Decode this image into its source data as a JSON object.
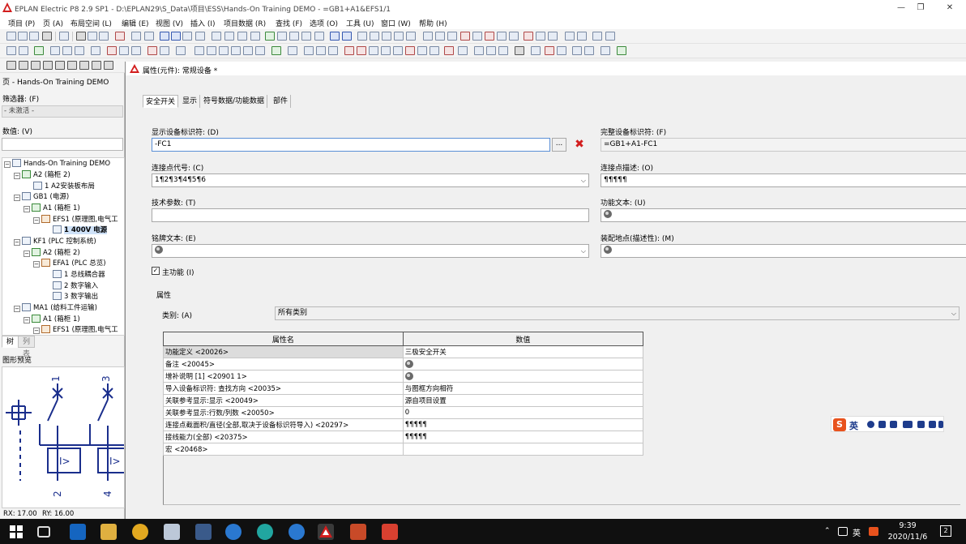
{
  "window": {
    "title": "EPLAN Electric P8 2.9 SP1 - D:\\EPLAN29\\S_Data\\项目\\ESS\\Hands-On Training DEMO - =GB1+A1&EFS1/1",
    "minimize": "—",
    "maximize": "❐",
    "close": "✕"
  },
  "menu": [
    "项目 (P)",
    "页 (A)",
    "布局空间 (L)",
    "编辑 (E)",
    "视图 (V)",
    "插入 (I)",
    "项目数据 (R)",
    "查找 (F)",
    "选项 (O)",
    "工具 (U)",
    "窗口 (W)",
    "帮助 (H)"
  ],
  "left_panel": {
    "title": "页 - Hands-On Training DEMO",
    "filter_label": "筛选器: (F)",
    "filter_value": "- 未激活 -",
    "value_label": "数值: (V)",
    "tree": [
      {
        "level": 0,
        "expander": "−",
        "icon": "project",
        "text": "Hands-On Training DEMO"
      },
      {
        "level": 1,
        "expander": "−",
        "icon": "cabinet",
        "text": "A2 (箱柜 2)"
      },
      {
        "level": 2,
        "expander": "",
        "icon": "page",
        "text": "1 A2安装板布局"
      },
      {
        "level": 1,
        "expander": "−",
        "icon": "function",
        "text": "GB1 (电源)"
      },
      {
        "level": 2,
        "expander": "−",
        "icon": "cabinet",
        "text": "A1 (箱柜 1)"
      },
      {
        "level": 3,
        "expander": "−",
        "icon": "schematic",
        "text": "EFS1 (原理图,电气工"
      },
      {
        "level": 4,
        "expander": "",
        "icon": "page",
        "text": "1 400V 电源",
        "selected": true
      },
      {
        "level": 1,
        "expander": "−",
        "icon": "function",
        "text": "KF1 (PLC 控制系统)"
      },
      {
        "level": 2,
        "expander": "−",
        "icon": "cabinet",
        "text": "A2 (箱柜 2)"
      },
      {
        "level": 3,
        "expander": "−",
        "icon": "schematic",
        "text": "EFA1 (PLC 总览)"
      },
      {
        "level": 4,
        "expander": "",
        "icon": "page",
        "text": "1 总线耦合器"
      },
      {
        "level": 4,
        "expander": "",
        "icon": "page",
        "text": "2 数字输入"
      },
      {
        "level": 4,
        "expander": "",
        "icon": "page",
        "text": "3 数字输出"
      },
      {
        "level": 1,
        "expander": "−",
        "icon": "function",
        "text": "MA1 (给料工件运输)"
      },
      {
        "level": 2,
        "expander": "−",
        "icon": "cabinet",
        "text": "A1 (箱柜 1)"
      },
      {
        "level": 3,
        "expander": "−",
        "icon": "schematic",
        "text": "EFS1 (原理图,电气工"
      }
    ],
    "tabs": [
      "树",
      "列表"
    ],
    "preview_title": "图形预览",
    "status_rx": "RX: 17.00",
    "status_ry": "RY: 16.00"
  },
  "dialog": {
    "title": "属性(元件): 常规设备 *",
    "tabs": [
      "安全开关",
      "显示",
      "符号数据/功能数据",
      "部件"
    ],
    "fields": {
      "display_dt_label": "显示设备标识符: (D)",
      "display_dt_value": "-FC1",
      "ellipsis": "...",
      "delete": "✖",
      "full_dt_label": "完整设备标识符: (F)",
      "full_dt_value": "=GB1+A1-FC1",
      "conn_code_label": "连接点代号: (C)",
      "conn_code_value": "1¶2¶3¶4¶5¶6",
      "conn_desc_label": "连接点描述: (O)",
      "conn_desc_value": "¶¶¶¶¶",
      "tech_params_label": "技术参数: (T)",
      "tech_params_value": "",
      "func_text_label": "功能文本: (U)",
      "nameplate_label": "铭牌文本: (E)",
      "mount_loc_label": "装配地点(描述性): (M)",
      "main_function_label": "主功能 (I)",
      "main_function_checked": "✓"
    },
    "properties_group": "属性",
    "category_label": "类别: (A)",
    "category_value": "所有类别",
    "table": {
      "headers": [
        "属性名",
        "数值"
      ],
      "rows": [
        {
          "name": "功能定义 <20026>",
          "value": "三极安全开关",
          "globe": false
        },
        {
          "name": "备注 <20045>",
          "value": "",
          "globe": true
        },
        {
          "name": "增补说明 [1] <20901 1>",
          "value": "",
          "globe": true
        },
        {
          "name": "导入设备标识符: 查找方向 <20035>",
          "value": "与图框方向相符",
          "globe": false
        },
        {
          "name": "关联参考显示:显示 <20049>",
          "value": "源自项目设置",
          "globe": false
        },
        {
          "name": "关联参考显示:行数/列数 <20050>",
          "value": "0",
          "globe": false
        },
        {
          "name": "连接点截面积/直径(全部,取决于设备标识符导入) <20297>",
          "value": "¶¶¶¶¶",
          "globe": false
        },
        {
          "name": "接线能力(全部) <20375>",
          "value": "¶¶¶¶¶",
          "globe": false
        },
        {
          "name": "宏 <20468>",
          "value": "",
          "globe": false
        }
      ]
    }
  },
  "ime": {
    "logo": "S",
    "lang": "英"
  },
  "taskbar": {
    "tray_lang": "英",
    "time": "9:39",
    "date": "2020/11/6",
    "notifications": "2"
  },
  "colors": {
    "accent_red": "#d21d1d",
    "selection_blue": "#cfe2f8",
    "taskbar": "#101010",
    "ime_orange": "#e8521d"
  }
}
